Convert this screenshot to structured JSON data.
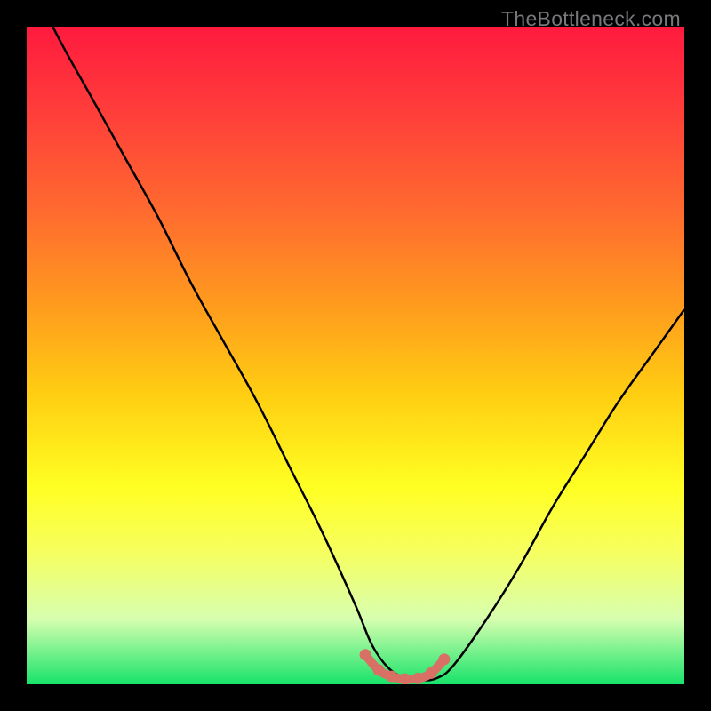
{
  "watermark": "TheBottleneck.com",
  "colors": {
    "gradient_top": "#ff1a3e",
    "gradient_bottom": "#17e36a",
    "curve": "#000000",
    "markers": "#d97066",
    "frame": "#000000"
  },
  "chart_data": {
    "type": "line",
    "title": "",
    "xlabel": "",
    "ylabel": "",
    "xlim": [
      0,
      100
    ],
    "ylim": [
      0,
      100
    ],
    "grid": false,
    "legend": false,
    "series": [
      {
        "name": "bottleneck-curve",
        "x": [
          0,
          5,
          10,
          15,
          20,
          25,
          30,
          35,
          40,
          45,
          50,
          52.5,
          55,
          57.5,
          60,
          62.5,
          65,
          70,
          75,
          80,
          85,
          90,
          95,
          100
        ],
        "y": [
          108,
          98,
          89,
          80,
          71,
          61,
          52,
          43,
          33,
          23,
          12,
          6,
          2.5,
          1,
          0.6,
          1,
          3,
          10,
          18,
          27,
          35,
          43,
          50,
          57
        ]
      }
    ],
    "highlight_segment": {
      "name": "optimal-range",
      "x": [
        51.5,
        53.5,
        55.5,
        57.5,
        59.5,
        61.5,
        63.5
      ],
      "y": [
        4.5,
        2.2,
        1.2,
        0.8,
        0.9,
        1.7,
        3.8
      ]
    }
  }
}
